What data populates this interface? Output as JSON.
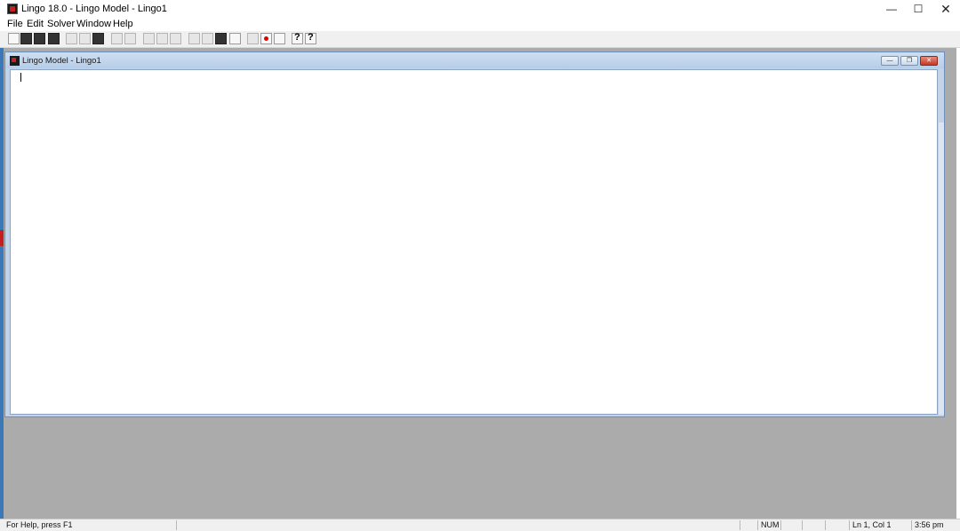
{
  "window": {
    "title": "Lingo 18.0 - Lingo Model - Lingo1",
    "minimize_label": "—",
    "maximize_label": "☐",
    "close_label": "✕"
  },
  "menu": [
    "File",
    "Edit",
    "Solver",
    "Window",
    "Help"
  ],
  "toolbar": {
    "buttons": [
      "new-icon",
      "open-icon",
      "save-icon",
      "print-icon",
      "cut-icon",
      "copy-icon",
      "paste-icon",
      "undo-icon",
      "redo-icon",
      "find-icon",
      "find-next-icon",
      "goto-line-icon",
      "match-parenthesis-icon",
      "solve-icon",
      "solution-icon",
      "matrix-picture-icon",
      "send-to-back-icon",
      "close-all-icon",
      "tile-icon",
      "help-icon",
      "help-pointer-icon"
    ]
  },
  "document": {
    "title": "Lingo Model - Lingo1",
    "minimize_label": "—",
    "restore_label": "❐",
    "close_label": "✕",
    "content": ""
  },
  "status": {
    "help_text": "For Help, press F1",
    "num": "NUM",
    "position": "Ln 1, Col 1",
    "time": "3:56 pm"
  },
  "colors": {
    "workspace": "#ababab",
    "child_frame": "#bfd3ea",
    "accent": "#3a78b7"
  }
}
